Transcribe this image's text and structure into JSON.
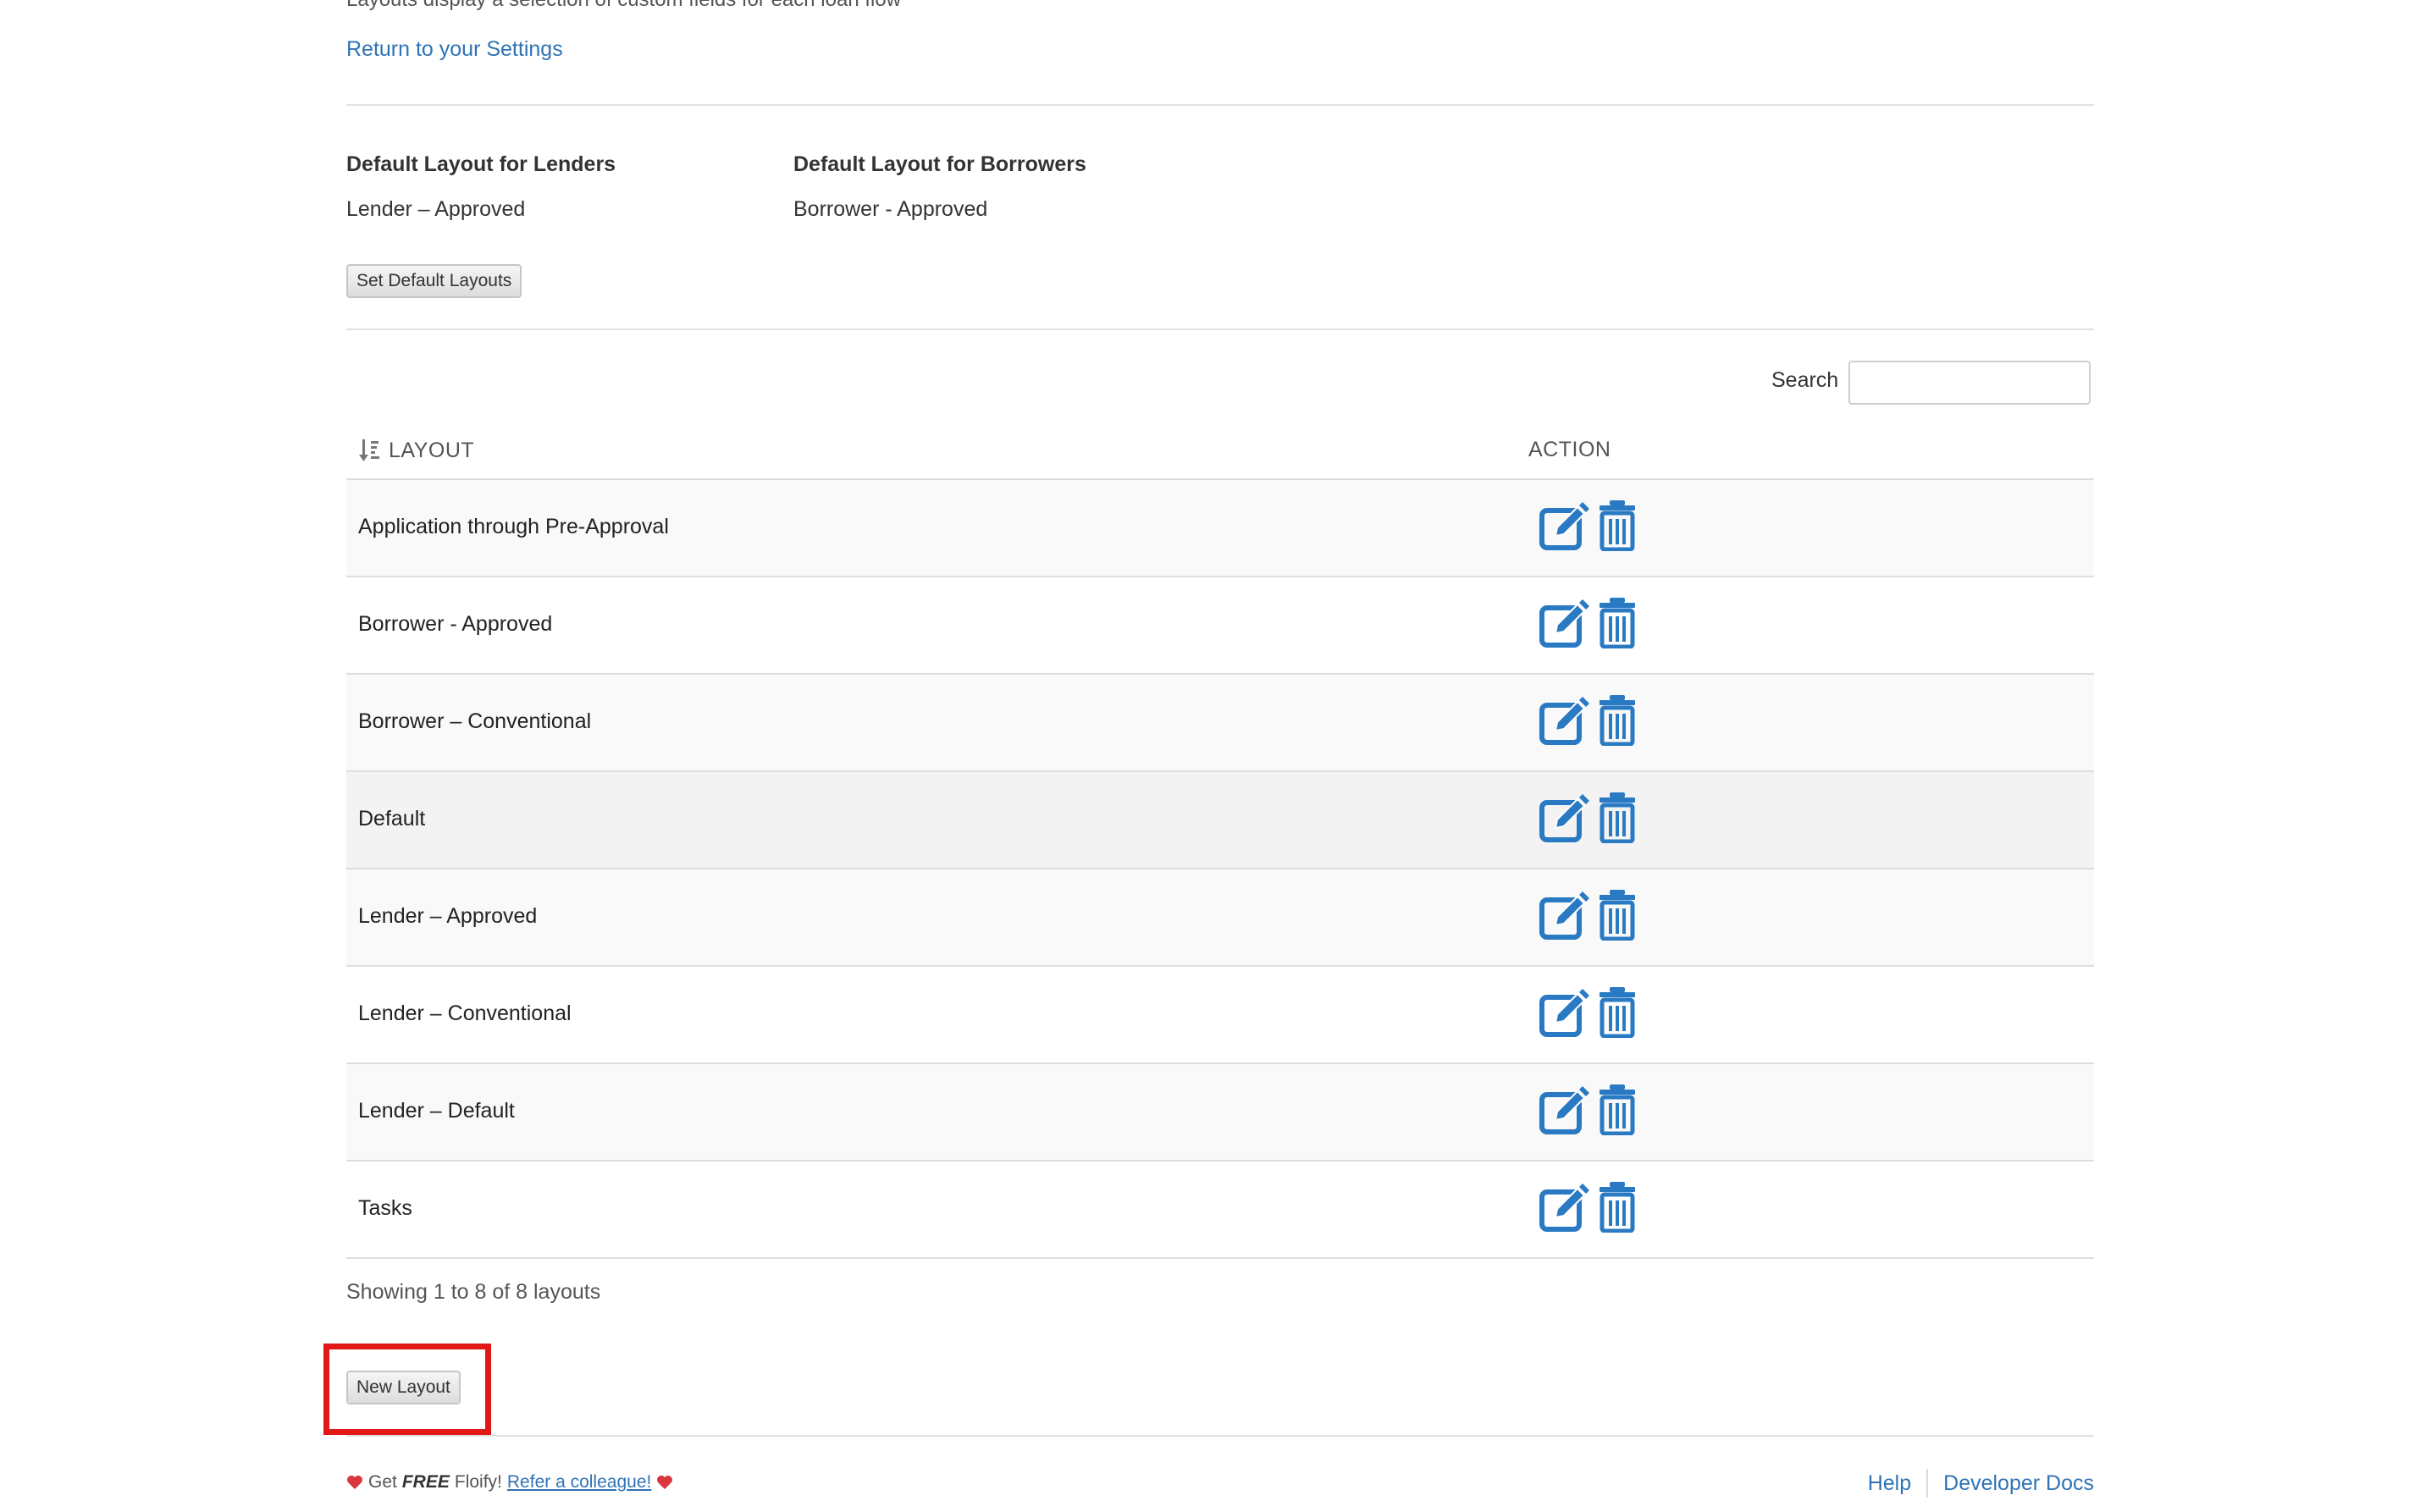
{
  "header": {
    "subtitle": "Layouts display a selection of custom fields for each loan flow",
    "return_link": "Return to your Settings"
  },
  "defaults": {
    "lenders_heading": "Default Layout for Lenders",
    "lenders_value": "Lender – Approved",
    "borrowers_heading": "Default Layout for Borrowers",
    "borrowers_value": "Borrower - Approved",
    "set_button": "Set Default Layouts"
  },
  "search": {
    "label": "Search",
    "value": "",
    "placeholder": ""
  },
  "table": {
    "columns": [
      "LAYOUT",
      "ACTION"
    ],
    "sort_icon": "sort-alpha-icon",
    "rows": [
      {
        "name": "Application through Pre-Approval"
      },
      {
        "name": "Borrower - Approved"
      },
      {
        "name": "Borrower – Conventional"
      },
      {
        "name": "Default"
      },
      {
        "name": "Lender – Approved"
      },
      {
        "name": "Lender – Conventional"
      },
      {
        "name": "Lender – Default"
      },
      {
        "name": "Tasks"
      }
    ],
    "row_actions": [
      "edit-icon",
      "trash-icon"
    ],
    "showing": "Showing 1 to 8 of 8 layouts"
  },
  "new_layout_button": "New Layout",
  "footer": {
    "get": "Get",
    "free": "FREE",
    "floify": "Floify!",
    "refer": "Refer a colleague!",
    "help": "Help",
    "developer_docs": "Developer Docs"
  },
  "colors": {
    "link": "#2f73b5",
    "icon": "#2a7ac3",
    "highlight": "#e01818",
    "heart": "#d9363e"
  }
}
